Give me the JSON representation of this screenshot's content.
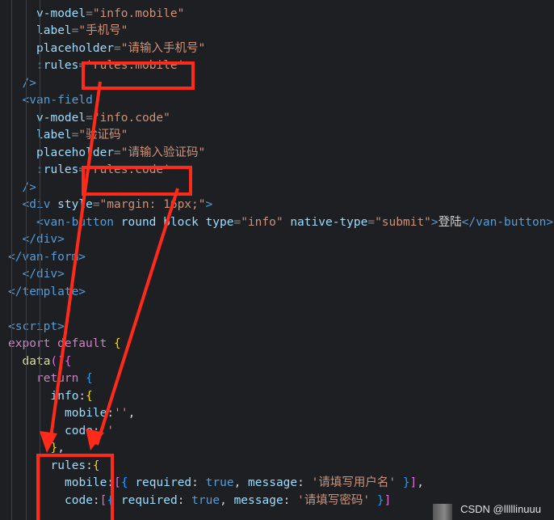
{
  "editor": {
    "lines": [
      {
        "indent": 1,
        "tokens": [
          [
            "tag",
            "<van-field"
          ]
        ]
      },
      {
        "indent": 2,
        "tokens": [
          [
            "attr",
            "v-model"
          ],
          [
            "punc",
            "="
          ],
          [
            "str",
            "\"info.mobile\""
          ]
        ]
      },
      {
        "indent": 2,
        "tokens": [
          [
            "attr",
            "label"
          ],
          [
            "punc",
            "="
          ],
          [
            "str",
            "\"手机号\""
          ]
        ]
      },
      {
        "indent": 2,
        "tokens": [
          [
            "attr",
            "placeholder"
          ],
          [
            "punc",
            "="
          ],
          [
            "str",
            "\"请输入手机号\""
          ]
        ]
      },
      {
        "indent": 2,
        "tokens": [
          [
            "attr",
            ":rules"
          ],
          [
            "punc",
            "="
          ],
          [
            "str",
            "'rules.mobile'"
          ]
        ]
      },
      {
        "indent": 1,
        "tokens": [
          [
            "tag",
            "/>"
          ]
        ]
      },
      {
        "indent": 1,
        "tokens": [
          [
            "tag",
            "<van-field"
          ]
        ]
      },
      {
        "indent": 2,
        "tokens": [
          [
            "attr",
            "v-model"
          ],
          [
            "punc",
            "="
          ],
          [
            "str",
            "\"info.code\""
          ]
        ]
      },
      {
        "indent": 2,
        "tokens": [
          [
            "attr",
            "label"
          ],
          [
            "punc",
            "="
          ],
          [
            "str",
            "\"验证码\""
          ]
        ]
      },
      {
        "indent": 2,
        "tokens": [
          [
            "attr",
            "placeholder"
          ],
          [
            "punc",
            "="
          ],
          [
            "str",
            "\"请输入验证码\""
          ]
        ]
      },
      {
        "indent": 2,
        "tokens": [
          [
            "attr",
            ":rules"
          ],
          [
            "punc",
            "="
          ],
          [
            "str",
            "'rules.code'"
          ]
        ]
      },
      {
        "indent": 1,
        "tokens": [
          [
            "tag",
            "/>"
          ]
        ]
      },
      {
        "indent": 1,
        "tokens": [
          [
            "tag",
            "<div "
          ],
          [
            "attr",
            "style"
          ],
          [
            "punc",
            "="
          ],
          [
            "str",
            "\"margin: 16px;\""
          ],
          [
            "tag",
            ">"
          ]
        ]
      },
      {
        "indent": 2,
        "tokens": [
          [
            "tag",
            "<van-button "
          ],
          [
            "attr",
            "round block type"
          ],
          [
            "punc",
            "="
          ],
          [
            "str",
            "\"info\""
          ],
          [
            "txt",
            " "
          ],
          [
            "attr",
            "native-type"
          ],
          [
            "punc",
            "="
          ],
          [
            "str",
            "\"submit\""
          ],
          [
            "tag",
            ">"
          ],
          [
            "txt",
            "登陆"
          ],
          [
            "tag",
            "</van-button>"
          ]
        ]
      },
      {
        "indent": 1,
        "tokens": [
          [
            "tag",
            "</div>"
          ]
        ]
      },
      {
        "indent": 0,
        "tokens": [
          [
            "tag",
            "</van-form>"
          ]
        ]
      },
      {
        "indent": 1,
        "tokens": [
          [
            "tag",
            "</div>"
          ]
        ]
      },
      {
        "indent": 0,
        "tokens": [
          [
            "tag",
            "</template>"
          ]
        ]
      },
      {
        "indent": 0,
        "tokens": []
      },
      {
        "indent": 0,
        "tokens": [
          [
            "tag",
            "<script>"
          ]
        ]
      },
      {
        "indent": 0,
        "tokens": [
          [
            "kw",
            "export default "
          ],
          [
            "brace",
            "{"
          ]
        ]
      },
      {
        "indent": 1,
        "tokens": [
          [
            "fn",
            "data"
          ],
          [
            "brace2",
            "()"
          ],
          [
            "brace2",
            "{"
          ]
        ]
      },
      {
        "indent": 2,
        "tokens": [
          [
            "kw",
            "return "
          ],
          [
            "brace3",
            "{"
          ]
        ]
      },
      {
        "indent": 3,
        "tokens": [
          [
            "prop",
            "info"
          ],
          [
            "txt",
            ":"
          ],
          [
            "brace",
            "{"
          ]
        ]
      },
      {
        "indent": 4,
        "tokens": [
          [
            "prop",
            "mobile"
          ],
          [
            "txt",
            ":"
          ],
          [
            "str",
            "''"
          ],
          [
            "txt",
            ","
          ]
        ]
      },
      {
        "indent": 4,
        "tokens": [
          [
            "prop",
            "code"
          ],
          [
            "txt",
            ":"
          ],
          [
            "str",
            "''"
          ]
        ]
      },
      {
        "indent": 3,
        "tokens": [
          [
            "brace",
            "}"
          ],
          [
            "txt",
            ","
          ]
        ]
      },
      {
        "indent": 3,
        "tokens": [
          [
            "prop",
            "rules"
          ],
          [
            "txt",
            ":"
          ],
          [
            "brace",
            "{"
          ]
        ]
      },
      {
        "indent": 4,
        "tokens": [
          [
            "prop",
            "mobile"
          ],
          [
            "txt",
            ":"
          ],
          [
            "brace2",
            "["
          ],
          [
            "brace3",
            "{"
          ],
          [
            "txt",
            " "
          ],
          [
            "prop",
            "required"
          ],
          [
            "txt",
            ": "
          ],
          [
            "bool",
            "true"
          ],
          [
            "txt",
            ", "
          ],
          [
            "prop",
            "message"
          ],
          [
            "txt",
            ": "
          ],
          [
            "str",
            "'请填写用户名'"
          ],
          [
            "txt",
            " "
          ],
          [
            "brace3",
            "}"
          ],
          [
            "brace2",
            "]"
          ],
          [
            "txt",
            ","
          ]
        ]
      },
      {
        "indent": 4,
        "tokens": [
          [
            "prop",
            "code"
          ],
          [
            "txt",
            ":"
          ],
          [
            "brace2",
            "["
          ],
          [
            "brace3",
            "{"
          ],
          [
            "txt",
            " "
          ],
          [
            "prop",
            "required"
          ],
          [
            "txt",
            ": "
          ],
          [
            "bool",
            "true"
          ],
          [
            "txt",
            ", "
          ],
          [
            "prop",
            "message"
          ],
          [
            "txt",
            ": "
          ],
          [
            "str",
            "'请填写密码'"
          ],
          [
            "txt",
            " "
          ],
          [
            "brace3",
            "}"
          ],
          [
            "brace2",
            "]"
          ]
        ]
      }
    ]
  },
  "watermark": "CSDN @lllllinuuu",
  "colors": {
    "background": "#1e1f22",
    "annotation": "#ff2a1a"
  }
}
